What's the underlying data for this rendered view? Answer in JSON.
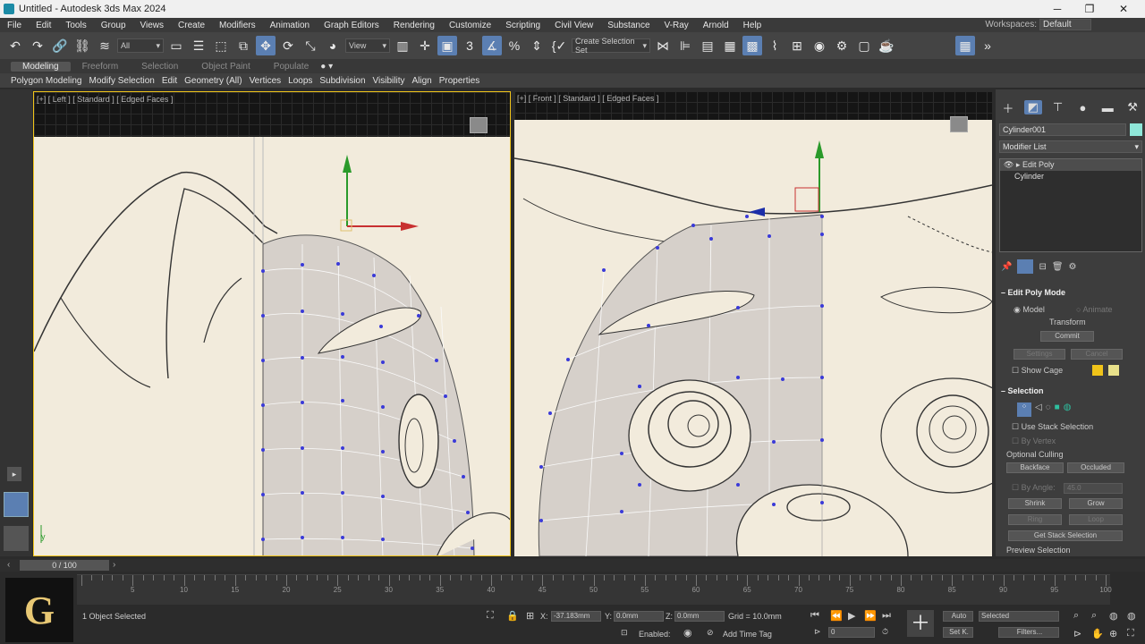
{
  "window": {
    "title": "Untitled - Autodesk 3ds Max 2024",
    "minimize": "─",
    "maximize": "❐",
    "close": "✕"
  },
  "menu": [
    "File",
    "Edit",
    "Tools",
    "Group",
    "Views",
    "Create",
    "Modifiers",
    "Animation",
    "Graph Editors",
    "Rendering",
    "Customize",
    "Scripting",
    "Civil View",
    "Substance",
    "V-Ray",
    "Arnold",
    "Help"
  ],
  "workspace": {
    "label": "Workspaces:",
    "value": "Default"
  },
  "toolbar": {
    "filter": "All",
    "view": "View",
    "selection_set": "Create Selection Set"
  },
  "ribbon_tabs": [
    "Modeling",
    "Freeform",
    "Selection",
    "Object Paint",
    "Populate"
  ],
  "ribbon_sections": [
    "Polygon Modeling",
    "Modify Selection",
    "Edit",
    "Geometry (All)",
    "Vertices",
    "Loops",
    "Subdivision",
    "Visibility",
    "Align",
    "Properties"
  ],
  "viewports": {
    "left": "[+] [ Left ] [ Standard ] [ Edged Faces ]",
    "front": "[+] [ Front ] [ Standard ] [ Edged Faces ]"
  },
  "command_panel": {
    "object_name": "Cylinder001",
    "object_color": "#8fe6d8",
    "modifier_list": "Modifier List",
    "stack": [
      "Edit Poly",
      "Cylinder"
    ],
    "edit_poly_mode": {
      "title": "Edit Poly Mode",
      "model": "Model",
      "animate": "Animate",
      "transform": "Transform",
      "commit": "Commit",
      "settings": "Settings",
      "cancel": "Cancel",
      "show_cage": "Show Cage",
      "cage_color1": "#f0c419",
      "cage_color2": "#e8e08a"
    },
    "selection": {
      "title": "Selection",
      "use_stack": "Use Stack Selection",
      "by_vertex": "By Vertex",
      "optional_culling": "Optional Culling",
      "backface": "Backface",
      "occluded": "Occluded",
      "by_angle": "By Angle:",
      "angle_value": "45.0",
      "shrink": "Shrink",
      "grow": "Grow",
      "ring": "Ring",
      "loop": "Loop",
      "get_stack": "Get Stack Selection",
      "preview": "Preview Selection"
    }
  },
  "timeline": {
    "slider": "0 / 100",
    "ticks": [
      "5",
      "10",
      "15",
      "20",
      "25",
      "30",
      "35",
      "40",
      "45",
      "50",
      "55",
      "60",
      "65",
      "70",
      "75",
      "80",
      "85",
      "90",
      "95",
      "100"
    ]
  },
  "status": {
    "selected": "1 Object Selected",
    "x_label": "X:",
    "x": "-37.183mm",
    "y_label": "Y:",
    "y": "0.0mm",
    "z_label": "Z:",
    "z": "0.0mm",
    "grid": "Grid = 10.0mm",
    "enabled": "Enabled:",
    "add_time_tag": "Add Time Tag",
    "auto": "Auto",
    "selected_dd": "Selected",
    "set_key": "Set K.",
    "filters": "Filters...",
    "frame": "0"
  },
  "logo": "G"
}
